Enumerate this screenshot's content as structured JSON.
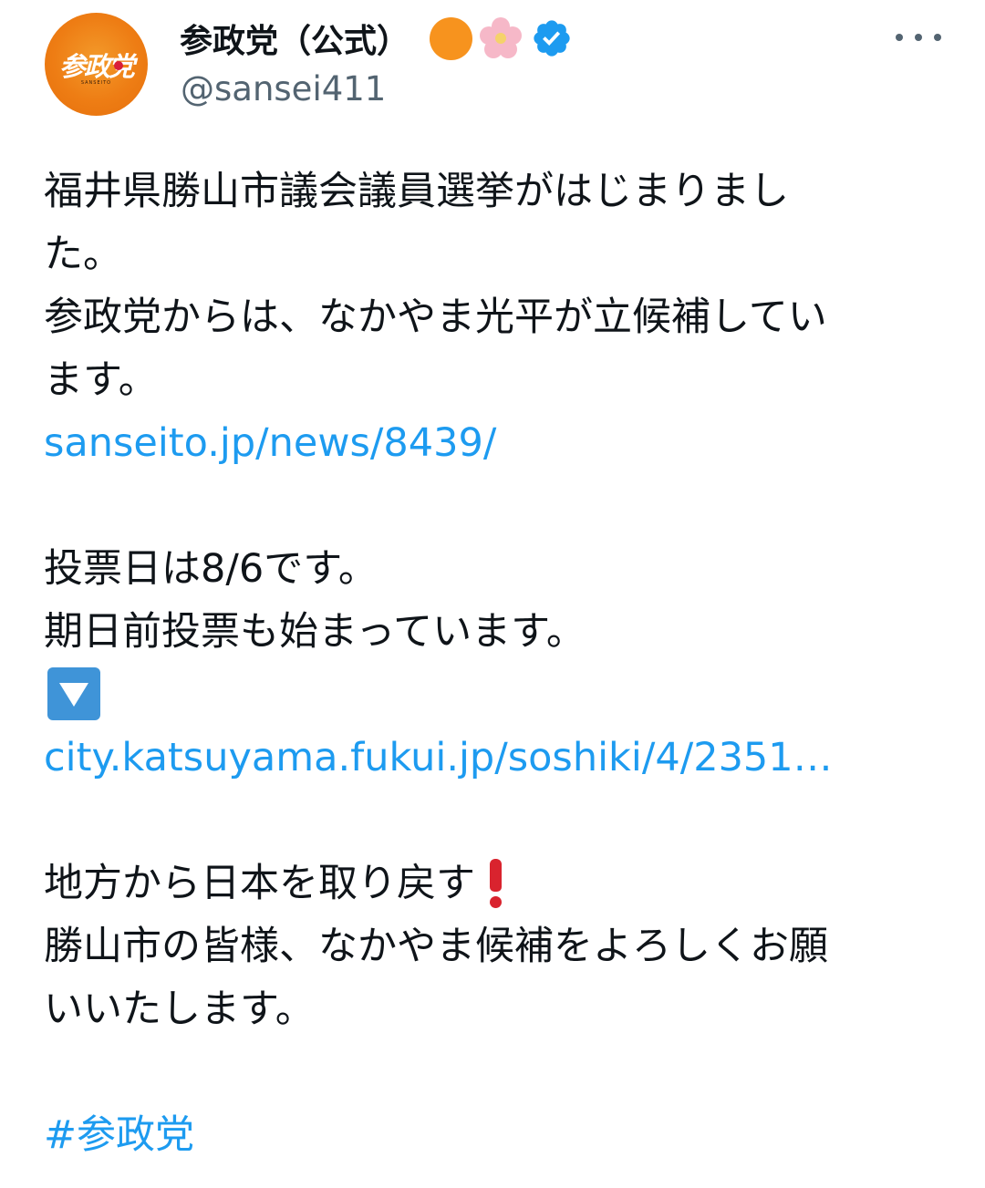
{
  "user": {
    "display_name": "参政党（公式）",
    "handle": "@sansei411",
    "avatar_logo_text": "参政党",
    "avatar_logo_subtext": "SANSEITO",
    "badges": [
      "orange-circle-icon",
      "cherry-blossom-icon",
      "verified-badge-icon"
    ],
    "verified_color": "#1d9bf0"
  },
  "menu": {
    "more_icon": "more-horizontal-icon"
  },
  "tweet": {
    "line1": "福井県勝山市議会議員選挙がはじまりまし",
    "line2": "た。",
    "line3": "参政党からは、なかやま光平が立候補してい",
    "line4": "ます。",
    "link1": "sanseito.jp/news/8439/",
    "line6": "投票日は8/6です。",
    "line7": "期日前投票も始まっています。",
    "down_icon": "down-arrow-button-icon",
    "link2": "city.katsuyama.fukui.jp/soshiki/4/2351…",
    "line10": "地方から日本を取り戻す",
    "exclaim_icon": "red-exclamation-icon",
    "line11": "勝山市の皆様、なかやま候補をよろしくお願",
    "line12": "いいたします。",
    "hashtag": "#参政党"
  },
  "colors": {
    "text": "#0f1419",
    "secondary": "#536471",
    "link": "#1d9bf0",
    "avatar": "#ee7d14"
  }
}
